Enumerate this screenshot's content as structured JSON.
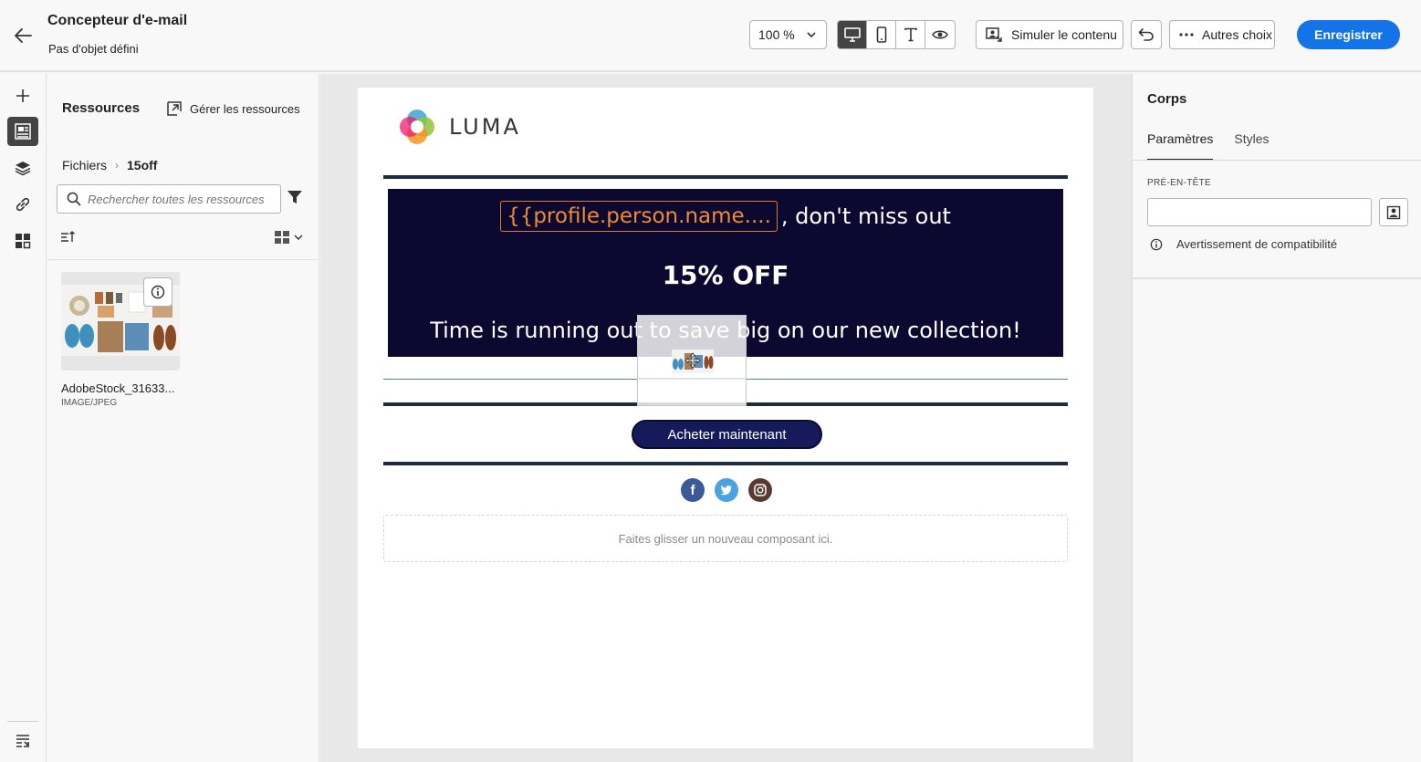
{
  "header": {
    "title": "Concepteur d'e-mail",
    "subtitle": "Pas d'objet défini",
    "zoom_value": "100 %",
    "simulate_label": "Simuler le contenu",
    "more_label": "Autres choix",
    "save_label": "Enregistrer",
    "accent_color": "#1473e6"
  },
  "rail": {
    "icons": [
      "plus-icon",
      "assets-icon",
      "layers-icon",
      "link-icon",
      "fragments-icon",
      "layers-settings-icon"
    ]
  },
  "resources": {
    "title": "Ressources",
    "manage_label": "Gérer les ressources",
    "breadcrumb_root": "Fichiers",
    "breadcrumb_current": "15off",
    "search_placeholder": "Rechercher toutes les ressources",
    "asset": {
      "name": "AdobeStock_31633...",
      "type": "IMAGE/JPEG"
    }
  },
  "email": {
    "brand_name": "LUMA",
    "personalization_token": "{{profile.person.name....",
    "hero_line1_suffix": ", don't miss out",
    "hero_offer": "15% OFF",
    "hero_line3": "Time is running out to save big on our new collection!",
    "cta_label": "Acheter maintenant",
    "social_icons": [
      "facebook-icon",
      "twitter-icon",
      "instagram-icon"
    ],
    "dropzone_label": "Faites glisser un nouveau composant ici.",
    "hero_bg": "#0b0930",
    "token_color": "#f08a35",
    "cta_bg": "#151b5a"
  },
  "properties": {
    "title": "Corps",
    "tabs": [
      "Paramètres",
      "Styles"
    ],
    "active_tab": "Paramètres",
    "preheader_label": "PRÉ-EN-TÊTE",
    "preheader_value": "",
    "compat_label": "Avertissement de compatibilité"
  }
}
